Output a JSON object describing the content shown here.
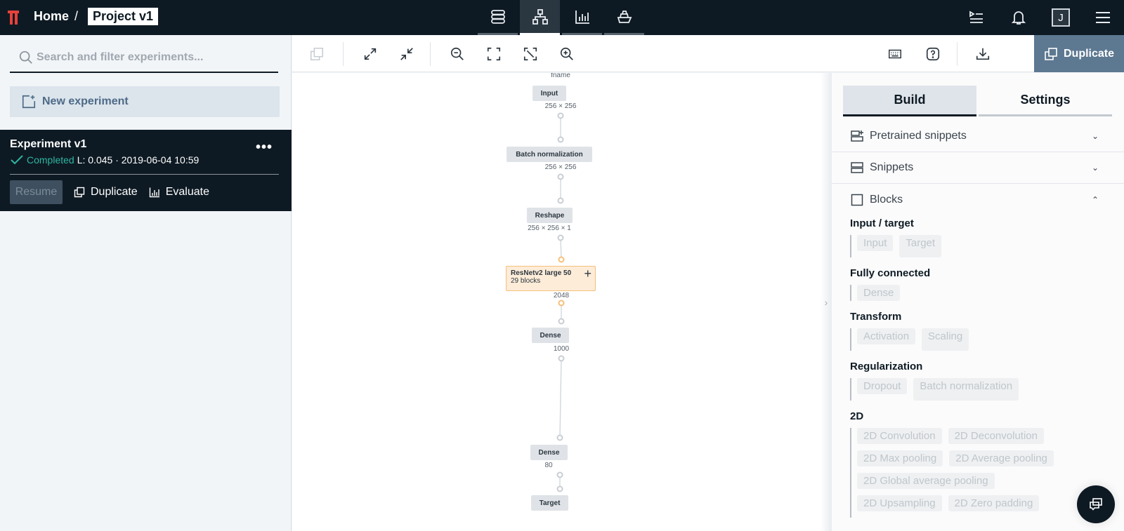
{
  "topbar": {
    "logo": "peltarion-logo",
    "breadcrumb": {
      "home": "Home",
      "separator": "/",
      "project": "Project v1"
    },
    "nav_tabs": [
      {
        "name": "datasets",
        "icon": "database-icon",
        "active": false
      },
      {
        "name": "modeling",
        "icon": "network-icon",
        "active": true
      },
      {
        "name": "evaluation",
        "icon": "bar-chart-icon",
        "active": false
      },
      {
        "name": "deployment",
        "icon": "ship-icon",
        "active": false
      }
    ],
    "right_icons": [
      "run-queue-icon",
      "bell-icon",
      "avatar",
      "menu-icon"
    ],
    "avatar_initial": "J"
  },
  "sidebar": {
    "search_placeholder": "Search and filter experiments...",
    "new_experiment_label": "New experiment",
    "experiment": {
      "title": "Experiment v1",
      "status": "Completed",
      "meta": "L: 0.045 · 2019-06-04 10:59",
      "more": "•••",
      "actions": {
        "resume": "Resume",
        "duplicate": "Duplicate",
        "evaluate": "Evaluate"
      }
    }
  },
  "toolbar": {
    "left_icons": [
      "copy-icon",
      "expand-icon",
      "collapse-icon",
      "zoom-out-icon",
      "fit-icon",
      "fit-selection-icon",
      "zoom-in-icon"
    ],
    "right_icons": [
      "keyboard-icon",
      "help-icon",
      "download-icon"
    ],
    "duplicate_label": "Duplicate"
  },
  "graph": {
    "top_label": "fname",
    "nodes": [
      {
        "name": "Input",
        "output": "256 × 256"
      },
      {
        "name": "Batch normalization",
        "output": "256 × 256"
      },
      {
        "name": "Reshape",
        "output": "256 × 256 × 1"
      },
      {
        "name": "ResNetv2 large 50",
        "sub": "29 blocks",
        "output": "2048",
        "highlight": true
      },
      {
        "name": "Dense",
        "output": "1000"
      },
      {
        "name": "Dense",
        "output": "80"
      },
      {
        "name": "Target"
      }
    ],
    "highlight_color": "#f5c07a"
  },
  "rpanel": {
    "tabs": [
      {
        "label": "Build",
        "active": true
      },
      {
        "label": "Settings",
        "active": false
      }
    ],
    "accordions": [
      {
        "label": "Pretrained snippets",
        "icon": "pretrained-snippets-icon",
        "chevron": "⌄",
        "open": false
      },
      {
        "label": "Snippets",
        "icon": "snippets-icon",
        "chevron": "⌄",
        "open": false
      },
      {
        "label": "Blocks",
        "icon": "blocks-icon",
        "chevron": "⌃",
        "open": true
      }
    ],
    "block_groups": [
      {
        "title": "Input / target",
        "items": [
          "Input",
          "Target"
        ]
      },
      {
        "title": "Fully connected",
        "items": [
          "Dense"
        ]
      },
      {
        "title": "Transform",
        "items": [
          "Activation",
          "Scaling"
        ]
      },
      {
        "title": "Regularization",
        "items": [
          "Dropout",
          "Batch normalization"
        ]
      },
      {
        "title": "2D",
        "items": [
          "2D Convolution",
          "2D Deconvolution",
          "2D Max pooling",
          "2D Average pooling",
          "2D Global average pooling",
          "2D Upsampling",
          "2D Zero padding"
        ]
      }
    ]
  },
  "colors": {
    "topbar_bg": "#0e1a23",
    "accent_status": "#2fb5a2",
    "duplicate_bg": "#5d7891",
    "logo_red": "#e8413c"
  }
}
